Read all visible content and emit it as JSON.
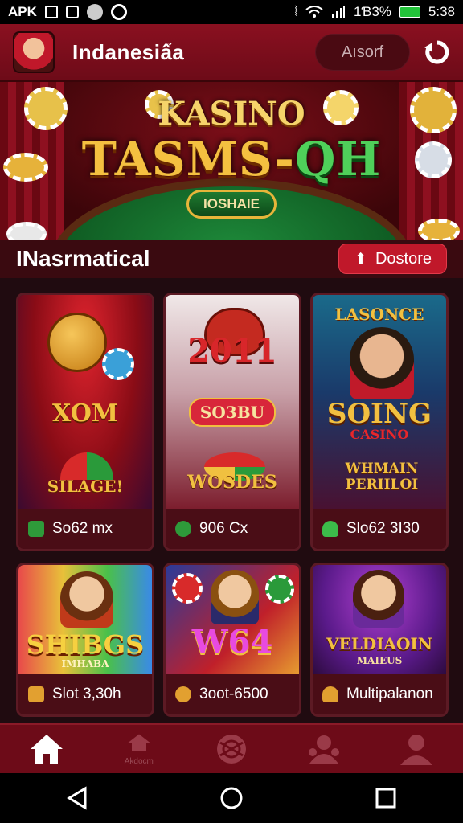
{
  "status_bar": {
    "left_label": "APK",
    "battery_text": "1Ɓ3%",
    "time": "5:38",
    "icons": [
      "notification-box-icon",
      "gallery-icon",
      "game-icon",
      "whatsapp-icon",
      "vibrate-icon",
      "wifi-icon",
      "signal-icon",
      "battery-icon"
    ],
    "battery_color": "#22c43a"
  },
  "app_bar": {
    "title": "Indanesiẩa",
    "account_label": "Aısorf",
    "logo_icon": "avatar-logo-icon",
    "action_icon": "refresh-icon",
    "background": "#7a0e1c"
  },
  "hero": {
    "top_text": "KASINO",
    "main_text_left": "TASMS-",
    "main_text_right": "QH",
    "badge_text": "IOSHAIE"
  },
  "section": {
    "title": "INasrmatical",
    "button_label": "Dostore",
    "button_icon": "upload-icon",
    "accent": "#c0182a"
  },
  "games": [
    {
      "art_line1": "XOM",
      "art_line2": "SILAGE!",
      "footer_label": "So62 mx",
      "icon": "cash-icon",
      "icon_color": "#2e9a3a"
    },
    {
      "art_line1": "2011",
      "art_line2": "SO3BU",
      "art_line3": "WOSDES",
      "footer_label": "906 Cx",
      "icon": "coin-icon",
      "icon_color": "#2e9a3a"
    },
    {
      "art_line1": "LASONCE",
      "art_line2": "SOING",
      "art_line3": "CASINO",
      "art_line4": "WHMAIN PERIILOI",
      "footer_label": "Slo62 3I30",
      "icon": "heart-icon",
      "icon_color": "#3cbc4a"
    },
    {
      "art_line1": "SHIBGS",
      "art_line2": "IMHABA",
      "footer_label": "Slot 3,30h",
      "icon": "treasure-icon",
      "icon_color": "#e2a030"
    },
    {
      "art_line1": "W64",
      "footer_label": "3oot-6500",
      "icon": "coin-icon",
      "icon_color": "#e2a030"
    },
    {
      "art_line1": "VELDIAOIN",
      "art_line2": "MAIEUS",
      "footer_label": "Multipalanon",
      "icon": "heart-icon",
      "icon_color": "#e2a030"
    }
  ],
  "bottom_nav": {
    "items": [
      {
        "icon": "home-icon",
        "label": ""
      },
      {
        "icon": "store-icon",
        "label": "Akdocm"
      },
      {
        "icon": "wheel-icon",
        "label": ""
      },
      {
        "icon": "group-icon",
        "label": ""
      },
      {
        "icon": "profile-icon",
        "label": ""
      }
    ]
  },
  "system_nav": {
    "icons": [
      "back-icon",
      "home-circle-icon",
      "recents-icon"
    ]
  }
}
